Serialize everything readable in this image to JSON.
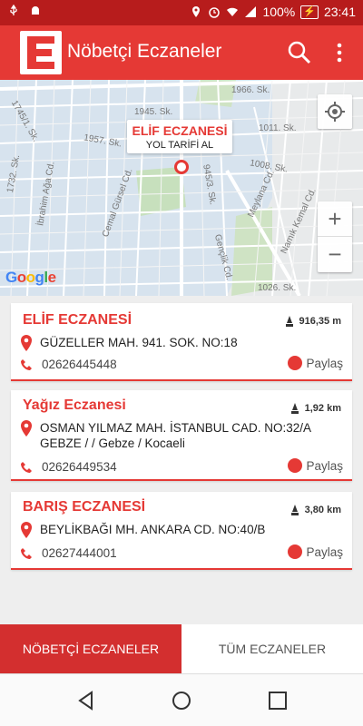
{
  "status_bar": {
    "battery": "100%",
    "time": "23:41"
  },
  "app": {
    "title": "Nöbetçi Eczaneler",
    "logo_letter": "E",
    "accent_color": "#e53935"
  },
  "map": {
    "streets": [
      "1966. Sk.",
      "1945. Sk.",
      "1011. Sk.",
      "1745/1. Sk.",
      "1957. Sk.",
      "1008. Sk.",
      "1732. Sk.",
      "İbrahim Ağa Cd.",
      "Cemal Gürsel Cd.",
      "945/3. Sk.",
      "Meylana Cd.",
      "Namık Kemal Cd.",
      "Gençlik Cd.",
      "1026. Sk."
    ],
    "marker_name": "ELİF ECZANESİ",
    "marker_action": "YOL TARİFİ AL",
    "attribution": "Google"
  },
  "pharmacies": [
    {
      "name": "ELİF ECZANESİ",
      "distance": "916,35 m",
      "address": "GÜZELLER MAH. 941. SOK. NO:18",
      "phone": "02626445448",
      "share": "Paylaş"
    },
    {
      "name": "Yağız Eczanesi",
      "distance": "1,92 km",
      "address": "OSMAN YILMAZ MAH. İSTANBUL CAD. NO:32/A GEBZE / / Gebze / Kocaeli",
      "phone": "02626449534",
      "share": "Paylaş"
    },
    {
      "name": "BARIŞ ECZANESİ",
      "distance": "3,80 km",
      "address": "BEYLİKBAĞI MH. ANKARA CD. NO:40/B",
      "phone": "02627444001",
      "share": "Paylaş"
    }
  ],
  "tabs": {
    "active": "NÖBETÇİ ECZANELER",
    "inactive": "TÜM ECZANELER"
  },
  "icons": [
    "usb-icon",
    "android-icon",
    "location-icon",
    "alarm-icon",
    "wifi-icon",
    "signal-icon",
    "search-icon",
    "more-vert-icon",
    "my-location-icon",
    "pin-icon",
    "phone-icon",
    "share-icon",
    "distance-icon",
    "back-icon",
    "home-icon",
    "recents-icon"
  ]
}
